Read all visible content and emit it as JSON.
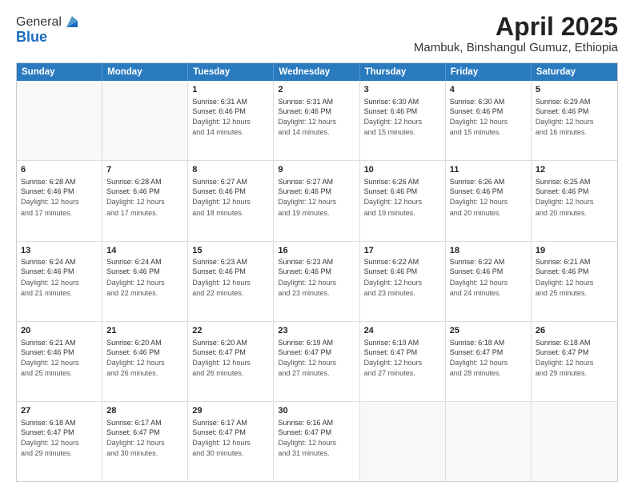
{
  "logo": {
    "general": "General",
    "blue": "Blue"
  },
  "title": "April 2025",
  "subtitle": "Mambuk, Binshangul Gumuz, Ethiopia",
  "days_of_week": [
    "Sunday",
    "Monday",
    "Tuesday",
    "Wednesday",
    "Thursday",
    "Friday",
    "Saturday"
  ],
  "weeks": [
    [
      {
        "day": "",
        "sunrise": "",
        "sunset": "",
        "daylight": ""
      },
      {
        "day": "",
        "sunrise": "",
        "sunset": "",
        "daylight": ""
      },
      {
        "day": "1",
        "sunrise": "Sunrise: 6:31 AM",
        "sunset": "Sunset: 6:46 PM",
        "daylight": "Daylight: 12 hours and 14 minutes."
      },
      {
        "day": "2",
        "sunrise": "Sunrise: 6:31 AM",
        "sunset": "Sunset: 6:46 PM",
        "daylight": "Daylight: 12 hours and 14 minutes."
      },
      {
        "day": "3",
        "sunrise": "Sunrise: 6:30 AM",
        "sunset": "Sunset: 6:46 PM",
        "daylight": "Daylight: 12 hours and 15 minutes."
      },
      {
        "day": "4",
        "sunrise": "Sunrise: 6:30 AM",
        "sunset": "Sunset: 6:46 PM",
        "daylight": "Daylight: 12 hours and 15 minutes."
      },
      {
        "day": "5",
        "sunrise": "Sunrise: 6:29 AM",
        "sunset": "Sunset: 6:46 PM",
        "daylight": "Daylight: 12 hours and 16 minutes."
      }
    ],
    [
      {
        "day": "6",
        "sunrise": "Sunrise: 6:28 AM",
        "sunset": "Sunset: 6:46 PM",
        "daylight": "Daylight: 12 hours and 17 minutes."
      },
      {
        "day": "7",
        "sunrise": "Sunrise: 6:28 AM",
        "sunset": "Sunset: 6:46 PM",
        "daylight": "Daylight: 12 hours and 17 minutes."
      },
      {
        "day": "8",
        "sunrise": "Sunrise: 6:27 AM",
        "sunset": "Sunset: 6:46 PM",
        "daylight": "Daylight: 12 hours and 18 minutes."
      },
      {
        "day": "9",
        "sunrise": "Sunrise: 6:27 AM",
        "sunset": "Sunset: 6:46 PM",
        "daylight": "Daylight: 12 hours and 19 minutes."
      },
      {
        "day": "10",
        "sunrise": "Sunrise: 6:26 AM",
        "sunset": "Sunset: 6:46 PM",
        "daylight": "Daylight: 12 hours and 19 minutes."
      },
      {
        "day": "11",
        "sunrise": "Sunrise: 6:26 AM",
        "sunset": "Sunset: 6:46 PM",
        "daylight": "Daylight: 12 hours and 20 minutes."
      },
      {
        "day": "12",
        "sunrise": "Sunrise: 6:25 AM",
        "sunset": "Sunset: 6:46 PM",
        "daylight": "Daylight: 12 hours and 20 minutes."
      }
    ],
    [
      {
        "day": "13",
        "sunrise": "Sunrise: 6:24 AM",
        "sunset": "Sunset: 6:46 PM",
        "daylight": "Daylight: 12 hours and 21 minutes."
      },
      {
        "day": "14",
        "sunrise": "Sunrise: 6:24 AM",
        "sunset": "Sunset: 6:46 PM",
        "daylight": "Daylight: 12 hours and 22 minutes."
      },
      {
        "day": "15",
        "sunrise": "Sunrise: 6:23 AM",
        "sunset": "Sunset: 6:46 PM",
        "daylight": "Daylight: 12 hours and 22 minutes."
      },
      {
        "day": "16",
        "sunrise": "Sunrise: 6:23 AM",
        "sunset": "Sunset: 6:46 PM",
        "daylight": "Daylight: 12 hours and 23 minutes."
      },
      {
        "day": "17",
        "sunrise": "Sunrise: 6:22 AM",
        "sunset": "Sunset: 6:46 PM",
        "daylight": "Daylight: 12 hours and 23 minutes."
      },
      {
        "day": "18",
        "sunrise": "Sunrise: 6:22 AM",
        "sunset": "Sunset: 6:46 PM",
        "daylight": "Daylight: 12 hours and 24 minutes."
      },
      {
        "day": "19",
        "sunrise": "Sunrise: 6:21 AM",
        "sunset": "Sunset: 6:46 PM",
        "daylight": "Daylight: 12 hours and 25 minutes."
      }
    ],
    [
      {
        "day": "20",
        "sunrise": "Sunrise: 6:21 AM",
        "sunset": "Sunset: 6:46 PM",
        "daylight": "Daylight: 12 hours and 25 minutes."
      },
      {
        "day": "21",
        "sunrise": "Sunrise: 6:20 AM",
        "sunset": "Sunset: 6:46 PM",
        "daylight": "Daylight: 12 hours and 26 minutes."
      },
      {
        "day": "22",
        "sunrise": "Sunrise: 6:20 AM",
        "sunset": "Sunset: 6:47 PM",
        "daylight": "Daylight: 12 hours and 26 minutes."
      },
      {
        "day": "23",
        "sunrise": "Sunrise: 6:19 AM",
        "sunset": "Sunset: 6:47 PM",
        "daylight": "Daylight: 12 hours and 27 minutes."
      },
      {
        "day": "24",
        "sunrise": "Sunrise: 6:19 AM",
        "sunset": "Sunset: 6:47 PM",
        "daylight": "Daylight: 12 hours and 27 minutes."
      },
      {
        "day": "25",
        "sunrise": "Sunrise: 6:18 AM",
        "sunset": "Sunset: 6:47 PM",
        "daylight": "Daylight: 12 hours and 28 minutes."
      },
      {
        "day": "26",
        "sunrise": "Sunrise: 6:18 AM",
        "sunset": "Sunset: 6:47 PM",
        "daylight": "Daylight: 12 hours and 29 minutes."
      }
    ],
    [
      {
        "day": "27",
        "sunrise": "Sunrise: 6:18 AM",
        "sunset": "Sunset: 6:47 PM",
        "daylight": "Daylight: 12 hours and 29 minutes."
      },
      {
        "day": "28",
        "sunrise": "Sunrise: 6:17 AM",
        "sunset": "Sunset: 6:47 PM",
        "daylight": "Daylight: 12 hours and 30 minutes."
      },
      {
        "day": "29",
        "sunrise": "Sunrise: 6:17 AM",
        "sunset": "Sunset: 6:47 PM",
        "daylight": "Daylight: 12 hours and 30 minutes."
      },
      {
        "day": "30",
        "sunrise": "Sunrise: 6:16 AM",
        "sunset": "Sunset: 6:47 PM",
        "daylight": "Daylight: 12 hours and 31 minutes."
      },
      {
        "day": "",
        "sunrise": "",
        "sunset": "",
        "daylight": ""
      },
      {
        "day": "",
        "sunrise": "",
        "sunset": "",
        "daylight": ""
      },
      {
        "day": "",
        "sunrise": "",
        "sunset": "",
        "daylight": ""
      }
    ]
  ]
}
